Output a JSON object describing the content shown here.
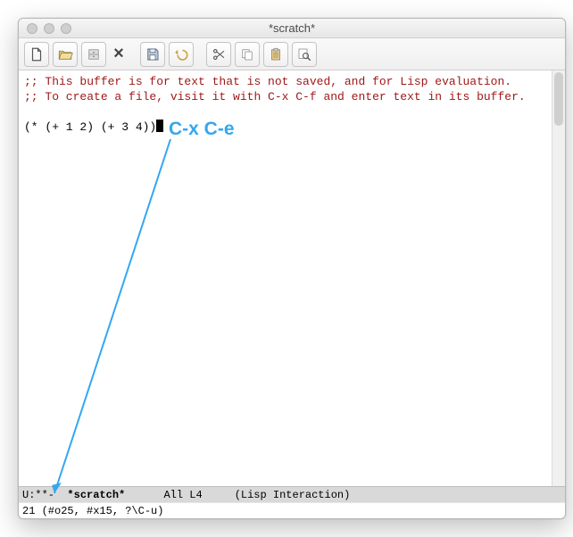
{
  "window": {
    "title": "*scratch*"
  },
  "toolbar": {
    "icons": [
      "new-file",
      "open-file",
      "save",
      "close",
      "floppy",
      "undo",
      "cut",
      "copy",
      "paste",
      "search"
    ]
  },
  "editor": {
    "comment1": ";; This buffer is for text that is not saved, and for Lisp evaluation.",
    "comment2": ";; To create a file, visit it with C-x C-f and enter text in its buffer.",
    "code": "(* (+ 1 2) (+ 3 4))"
  },
  "annotation": {
    "label": "C-x C-e"
  },
  "modeline": {
    "prefix": "U:",
    "modified": "**-",
    "buffer": "*scratch*",
    "position": "All",
    "line": "L4",
    "mode": "(Lisp Interaction)"
  },
  "minibuffer": {
    "text": "21 (#o25, #x15, ?\\C-u)"
  }
}
